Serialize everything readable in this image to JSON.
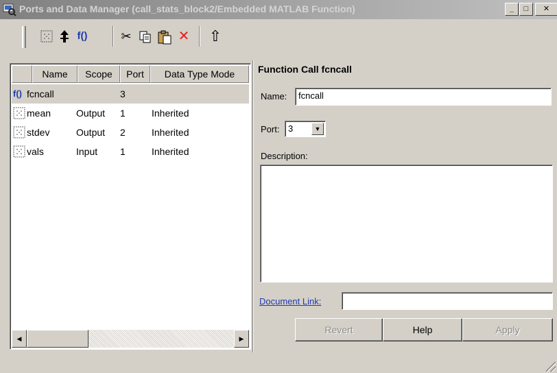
{
  "window": {
    "title": "Ports and Data Manager (call_stats_block2/Embedded MATLAB Function)",
    "controls": {
      "minimize": "_",
      "maximize": "□",
      "close": "✕"
    }
  },
  "toolbar": {
    "tools": [
      {
        "name": "add-data",
        "icon": "data-icon"
      },
      {
        "name": "add-event",
        "icon": "event-arrow-icon"
      },
      {
        "name": "add-function-call",
        "icon": "function-call-icon",
        "glyph": "f()"
      },
      {
        "name": "cut",
        "icon": "scissors-icon",
        "glyph": "✂"
      },
      {
        "name": "copy",
        "icon": "copy-icon"
      },
      {
        "name": "paste",
        "icon": "paste-icon"
      },
      {
        "name": "delete",
        "icon": "delete-x-icon",
        "glyph": "✕"
      },
      {
        "name": "move-up",
        "icon": "up-arrow-icon",
        "glyph": "⇧"
      }
    ]
  },
  "table": {
    "columns": [
      "Name",
      "Scope",
      "Port",
      "Data Type Mode"
    ],
    "rows": [
      {
        "icon": "function-call-icon",
        "name": "fcncall",
        "scope": "",
        "port": "3",
        "dtmode": "",
        "selected": true
      },
      {
        "icon": "data-icon",
        "name": "mean",
        "scope": "Output",
        "port": "1",
        "dtmode": "Inherited",
        "selected": false
      },
      {
        "icon": "data-icon",
        "name": "stdev",
        "scope": "Output",
        "port": "2",
        "dtmode": "Inherited",
        "selected": false
      },
      {
        "icon": "data-icon",
        "name": "vals",
        "scope": "Input",
        "port": "1",
        "dtmode": "Inherited",
        "selected": false
      }
    ]
  },
  "details": {
    "title": "Function Call fcncall",
    "name_label": "Name:",
    "name_value": "fcncall",
    "port_label": "Port:",
    "port_value": "3",
    "description_label": "Description:",
    "description_value": "",
    "doc_link_label": "Document Link:",
    "doc_link_value": ""
  },
  "buttons": {
    "revert": "Revert",
    "help": "Help",
    "apply": "Apply"
  },
  "colors": {
    "link": "#1f3bb0",
    "function_icon": "#1f3bb0",
    "delete_icon": "#e02020"
  }
}
